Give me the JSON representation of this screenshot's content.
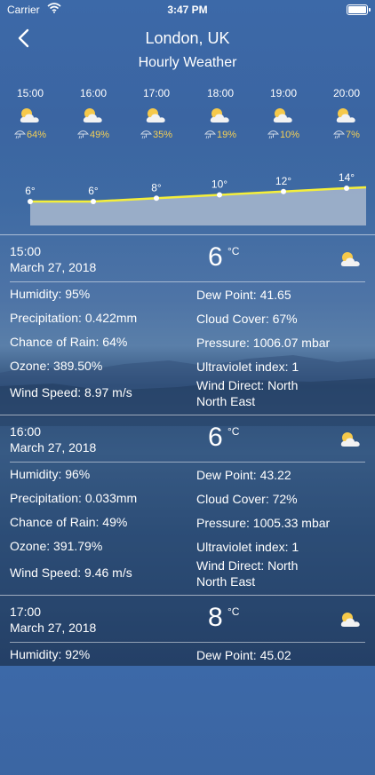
{
  "status": {
    "carrier": "Carrier",
    "time": "3:47 PM"
  },
  "header": {
    "title": "London, UK",
    "subtitle": "Hourly Weather"
  },
  "hours": [
    {
      "time": "15:00",
      "rain": "64%",
      "temp": "6°"
    },
    {
      "time": "16:00",
      "rain": "49%",
      "temp": "6°"
    },
    {
      "time": "17:00",
      "rain": "35%",
      "temp": "8°"
    },
    {
      "time": "18:00",
      "rain": "19%",
      "temp": "10°"
    },
    {
      "time": "19:00",
      "rain": "10%",
      "temp": "12°"
    },
    {
      "time": "20:00",
      "rain": "7%",
      "temp": "14°"
    }
  ],
  "chart_data": {
    "type": "area",
    "x": [
      "15:00",
      "16:00",
      "17:00",
      "18:00",
      "19:00",
      "20:00"
    ],
    "values": [
      6,
      6,
      8,
      10,
      12,
      14
    ],
    "data_labels": [
      "6°",
      "6°",
      "8°",
      "10°",
      "12°",
      "14°"
    ]
  },
  "colors": {
    "accent_rain": "#f3cf56",
    "line": "#f5ef3a",
    "area": "#a9b8cf"
  },
  "details": [
    {
      "time": "15:00",
      "date": "March 27, 2018",
      "temp": "6",
      "unit": "°C",
      "humidity": "Humidity: 95%",
      "dew": "Dew Point: 41.65",
      "precip": "Precipitation: 0.422mm",
      "cloud": "Cloud Cover: 67%",
      "chance": "Chance of Rain: 64%",
      "pressure": "Pressure: 1006.07 mbar",
      "ozone": "Ozone: 389.50%",
      "uv": "Ultraviolet index: 1",
      "wind": "Wind Speed: 8.97 m/s",
      "dir1": "Wind Direct: North",
      "dir2": "North East"
    },
    {
      "time": "16:00",
      "date": "March 27, 2018",
      "temp": "6",
      "unit": "°C",
      "humidity": "Humidity: 96%",
      "dew": "Dew Point: 43.22",
      "precip": "Precipitation: 0.033mm",
      "cloud": "Cloud Cover: 72%",
      "chance": "Chance of Rain: 49%",
      "pressure": "Pressure: 1005.33 mbar",
      "ozone": "Ozone: 391.79%",
      "uv": "Ultraviolet index: 1",
      "wind": "Wind Speed: 9.46 m/s",
      "dir1": "Wind Direct: North",
      "dir2": "North East"
    },
    {
      "time": "17:00",
      "date": "March 27, 2018",
      "temp": "8",
      "unit": "°C",
      "humidity": "Humidity: 92%",
      "dew": "Dew Point: 45.02"
    }
  ]
}
